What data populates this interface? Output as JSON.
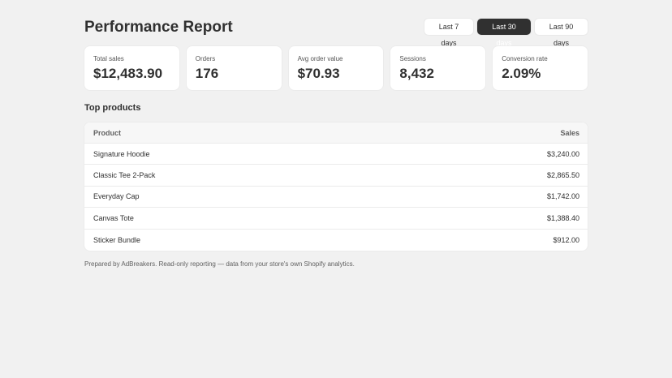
{
  "header": {
    "title": "Performance Report",
    "ranges": [
      "Last 7 days",
      "Last 30 days",
      "Last 90 days"
    ],
    "selected_range": "Last 30 days"
  },
  "metrics": [
    {
      "label": "Total sales",
      "value": "$12,483.90"
    },
    {
      "label": "Orders",
      "value": "176"
    },
    {
      "label": "Avg order value",
      "value": "$70.93"
    },
    {
      "label": "Sessions",
      "value": "8,432"
    },
    {
      "label": "Conversion rate",
      "value": "2.09%"
    }
  ],
  "top_products": {
    "title": "Top products",
    "columns": [
      "Product",
      "Sales"
    ],
    "rows": [
      {
        "product": "Signature Hoodie",
        "sales": "$3,240.00"
      },
      {
        "product": "Classic Tee 2-Pack",
        "sales": "$2,865.50"
      },
      {
        "product": "Everyday Cap",
        "sales": "$1,742.00"
      },
      {
        "product": "Canvas Tote",
        "sales": "$1,388.40"
      },
      {
        "product": "Sticker Bundle",
        "sales": "$912.00"
      }
    ]
  },
  "footer": {
    "note": "Prepared by AdBreakers. Read-only reporting — data from your store's own Shopify analytics."
  },
  "colors": {
    "background": "#f1f1f1",
    "card": "#ffffff",
    "text": "#303030",
    "active_button": "#303030"
  }
}
